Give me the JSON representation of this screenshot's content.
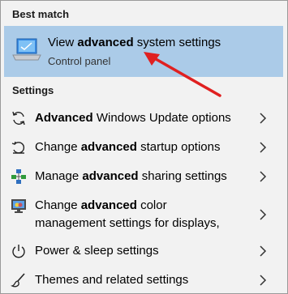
{
  "best_match": {
    "header": "Best match",
    "title_prefix": "View ",
    "title_bold": "advanced",
    "title_suffix": " system settings",
    "subtitle": "Control panel"
  },
  "settings": {
    "header": "Settings",
    "items": [
      {
        "pre": "",
        "bold": "Advanced",
        "post": " Windows Update options",
        "icon": "sync-icon"
      },
      {
        "pre": "Change ",
        "bold": "advanced",
        "post": " startup options",
        "icon": "restart-icon"
      },
      {
        "pre": "Manage ",
        "bold": "advanced",
        "post": " sharing settings",
        "icon": "network-sharing-icon"
      },
      {
        "pre": "Change ",
        "bold": "advanced",
        "post": " color",
        "line2": "management settings for displays,",
        "icon": "color-management-icon"
      },
      {
        "pre": "Power & sleep settings",
        "bold": "",
        "post": "",
        "icon": "power-icon"
      },
      {
        "pre": "Themes and related settings",
        "bold": "",
        "post": "",
        "icon": "brush-icon"
      }
    ]
  },
  "colors": {
    "selected_bg": "#abcbe8",
    "panel_bg": "#f2f2f2",
    "annotation_arrow": "#e02020"
  }
}
